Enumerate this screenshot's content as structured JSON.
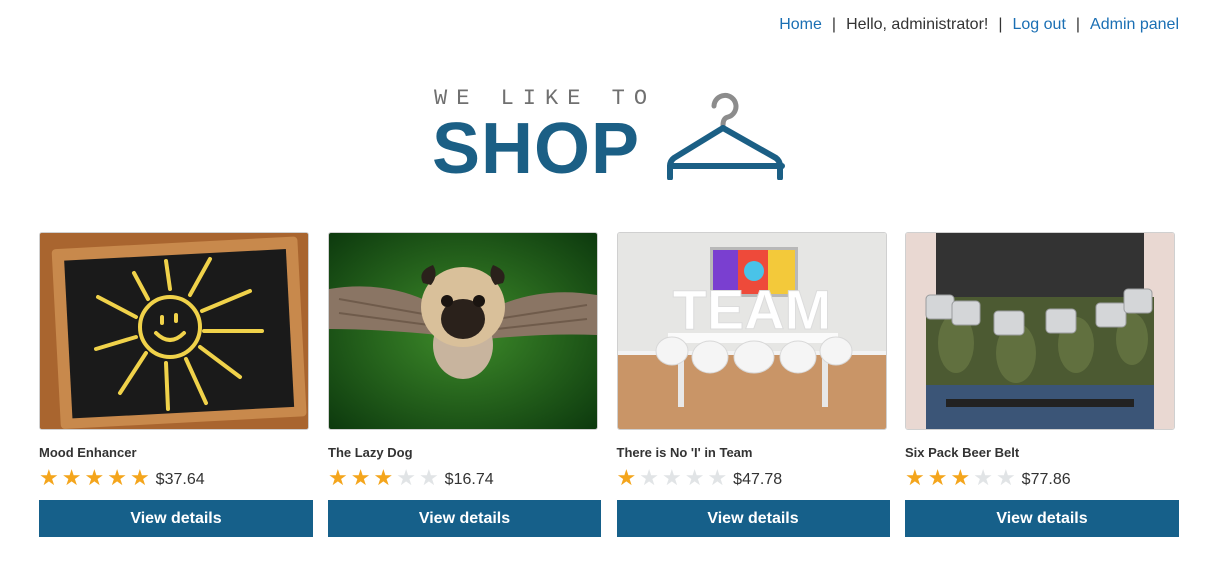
{
  "nav": {
    "home": "Home",
    "greeting": "Hello, administrator!",
    "logout": "Log out",
    "admin": "Admin panel",
    "separator": "|"
  },
  "logo": {
    "tagline": "WE LIKE TO",
    "word": "SHOP",
    "icon": "hanger-icon"
  },
  "colors": {
    "brand": "#1b5f85",
    "button": "#16608a",
    "link": "#1a6fb4",
    "star_on": "#f4a51c",
    "star_off": "#e1e4e6"
  },
  "products": [
    {
      "name": "Mood Enhancer",
      "rating": 5,
      "max_rating": 5,
      "price": "$37.64",
      "button": "View details",
      "image": "chalkboard-sun-image"
    },
    {
      "name": "The Lazy Dog",
      "rating": 3,
      "max_rating": 5,
      "price": "$16.74",
      "button": "View details",
      "image": "flying-pug-image"
    },
    {
      "name": "There is No 'I' in Team",
      "rating": 1,
      "max_rating": 5,
      "price": "$47.78",
      "button": "View details",
      "image": "team-meeting-room-image"
    },
    {
      "name": "Six Pack Beer Belt",
      "rating": 3,
      "max_rating": 5,
      "price": "$77.86",
      "button": "View details",
      "image": "beer-belt-image"
    }
  ]
}
